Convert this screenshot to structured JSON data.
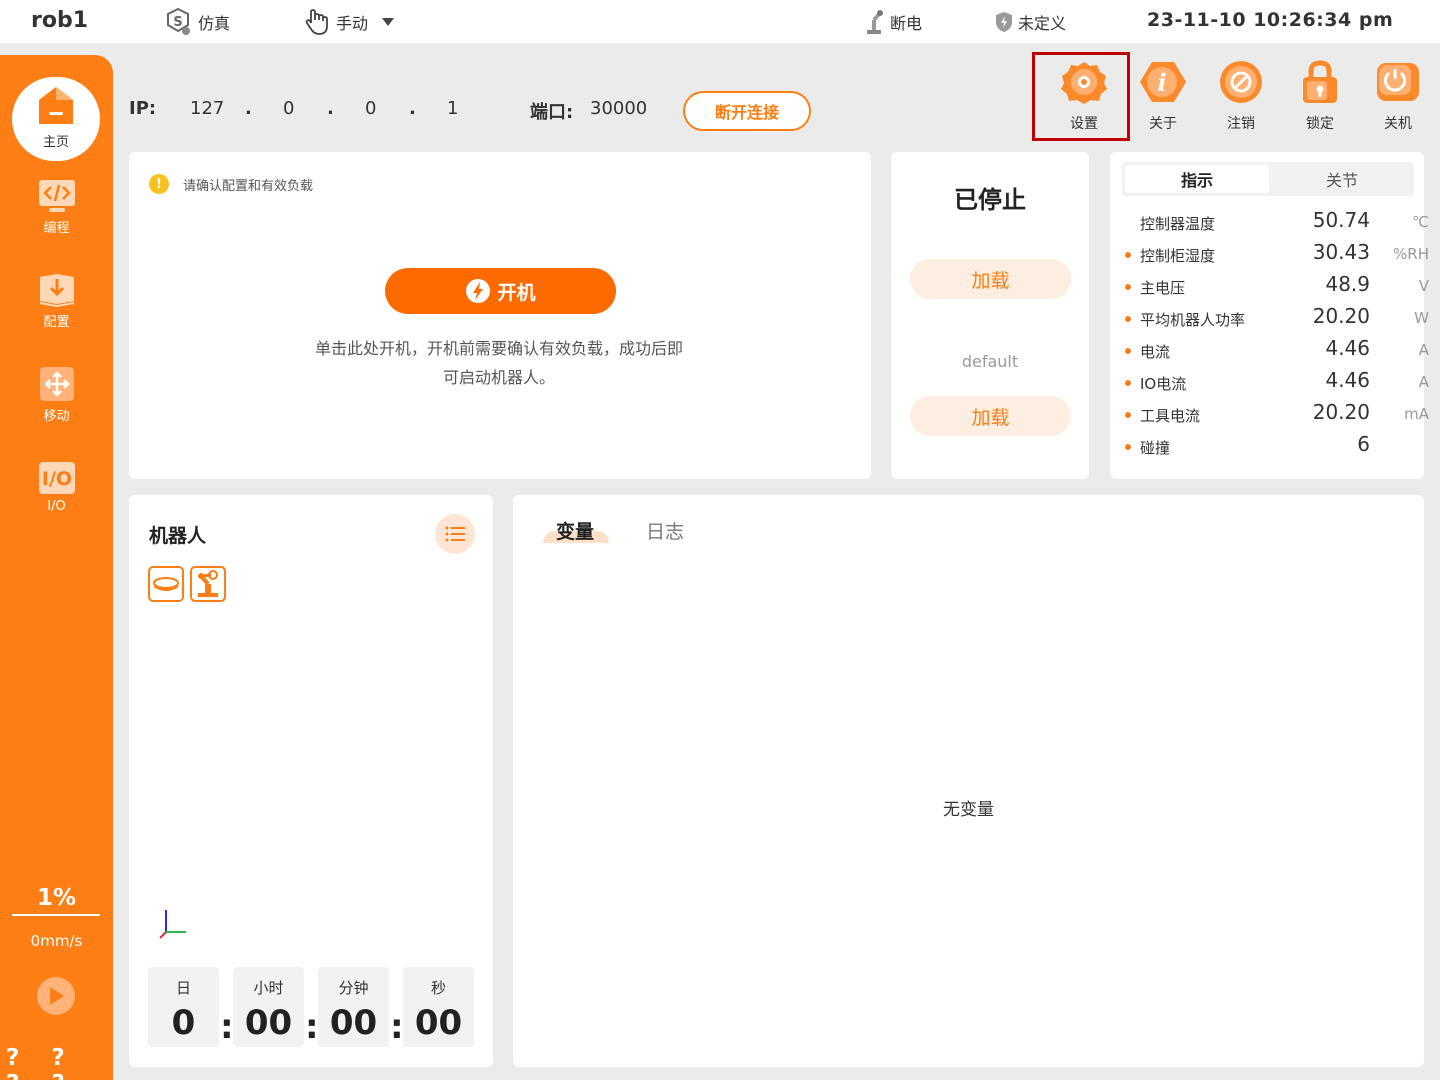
{
  "header": {
    "robot_name": "rob1",
    "sim_label": "仿真",
    "mode_label": "手动",
    "power_status": "断电",
    "safety_status": "未定义",
    "datetime": "23-11-10 10:26:34 pm"
  },
  "sidebar": {
    "home_label": "主页",
    "items": [
      {
        "label": "编程",
        "icon": "code-icon"
      },
      {
        "label": "配置",
        "icon": "config-download-icon"
      },
      {
        "label": "移动",
        "icon": "move-arrows-icon"
      },
      {
        "label": "I/O",
        "icon": "io-icon"
      }
    ],
    "speed_percent": "1%",
    "speed_value": "0mm/s",
    "bottom_text": "? ? ? ?"
  },
  "connection": {
    "ip_label": "IP:",
    "ip_parts": [
      "127",
      "0",
      "0",
      "1"
    ],
    "dot": ".",
    "port_label": "端口:",
    "port_value": "30000",
    "disconnect_label": "断开连接"
  },
  "actions": [
    {
      "label": "设置",
      "icon": "settings-gear-icon"
    },
    {
      "label": "关于",
      "icon": "info-icon"
    },
    {
      "label": "注销",
      "icon": "logout-cancel-icon"
    },
    {
      "label": "锁定",
      "icon": "lock-icon"
    },
    {
      "label": "关机",
      "icon": "power-off-icon"
    }
  ],
  "startup_panel": {
    "warning": "请确认配置和有效负载",
    "power_on_label": "开机",
    "description": "单击此处开机，开机前需要确认有效负载，成功后即可启动机器人。"
  },
  "state_panel": {
    "status": "已停止",
    "load_label_1": "加载",
    "payload_name": "default",
    "load_label_2": "加载"
  },
  "indicators": {
    "tabs": [
      "指示",
      "关节"
    ],
    "rows": [
      {
        "name": "控制器温度",
        "value": "50.74",
        "unit": "℃"
      },
      {
        "name": "控制柜湿度",
        "value": "30.43",
        "unit": "%RH"
      },
      {
        "name": "主电压",
        "value": "48.9",
        "unit": "V"
      },
      {
        "name": "平均机器人功率",
        "value": "20.20",
        "unit": "W"
      },
      {
        "name": "电流",
        "value": "4.46",
        "unit": "A"
      },
      {
        "name": "IO电流",
        "value": "4.46",
        "unit": "A"
      },
      {
        "name": "工具电流",
        "value": "20.20",
        "unit": "mA"
      },
      {
        "name": "碰撞",
        "value": "6",
        "unit": ""
      }
    ]
  },
  "robot_panel": {
    "title": "机器人",
    "timer": [
      {
        "label": "日",
        "value": "0"
      },
      {
        "label": "小时",
        "value": "00"
      },
      {
        "label": "分钟",
        "value": "00"
      },
      {
        "label": "秒",
        "value": "00"
      }
    ],
    "separator": ":"
  },
  "variables_panel": {
    "tabs": [
      "变量",
      "日志"
    ],
    "empty_text": "无变量"
  },
  "colors": {
    "accent": "#fd7e14",
    "highlight": "#c00000"
  }
}
